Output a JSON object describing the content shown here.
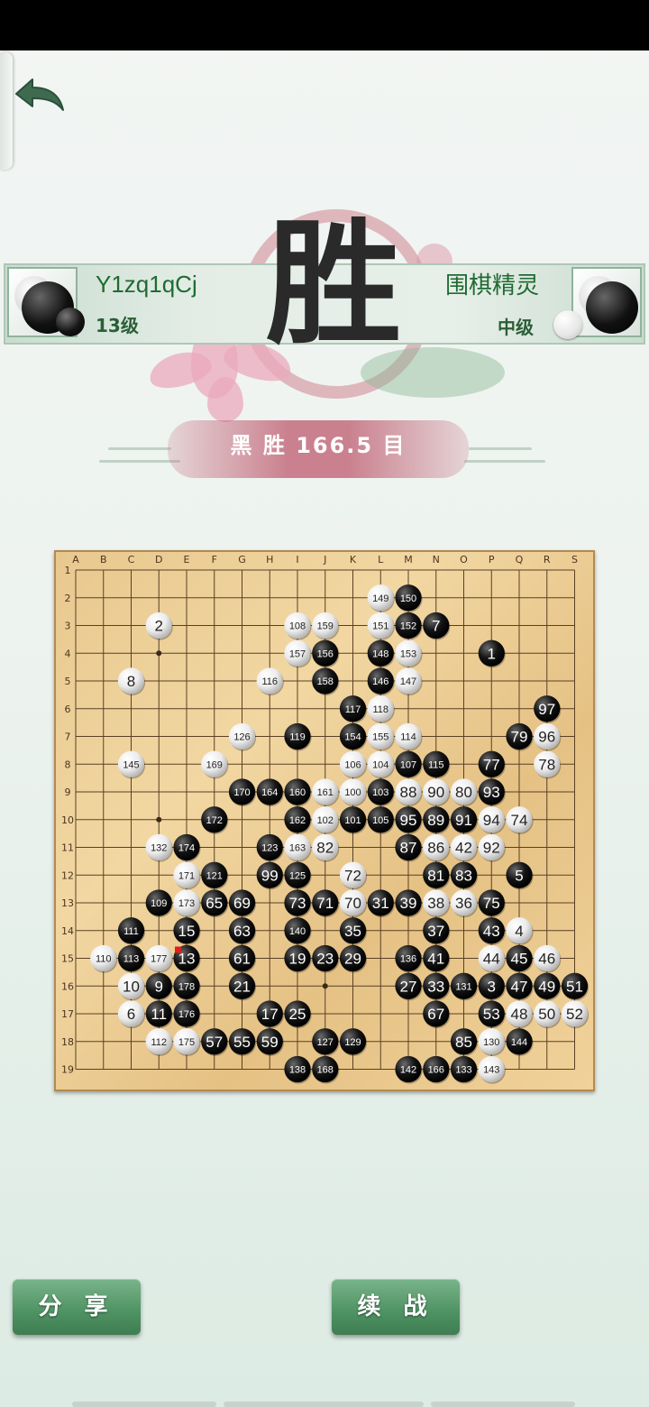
{
  "header": {
    "back_icon": "back-arrow-icon"
  },
  "players": {
    "black": {
      "name": "Y1zq1qCj",
      "rank": "13级",
      "color": "black"
    },
    "white": {
      "name": "围棋精灵",
      "rank": "中级",
      "color": "white"
    }
  },
  "result": {
    "headline": "胜",
    "detail": "黑 胜  166.5 目"
  },
  "board": {
    "size": 19,
    "col_labels": [
      "A",
      "B",
      "C",
      "D",
      "E",
      "F",
      "G",
      "H",
      "I",
      "J",
      "K",
      "L",
      "M",
      "N",
      "O",
      "P",
      "Q",
      "R",
      "S"
    ],
    "row_labels": [
      "1",
      "2",
      "3",
      "4",
      "5",
      "6",
      "7",
      "8",
      "9",
      "10",
      "11",
      "12",
      "13",
      "14",
      "15",
      "16",
      "17",
      "18",
      "19"
    ],
    "last_move_marker": "E15",
    "stones": [
      [
        "L2",
        "w",
        "149"
      ],
      [
        "M2",
        "b",
        "150"
      ],
      [
        "D3",
        "w",
        "2"
      ],
      [
        "I3",
        "w",
        "108"
      ],
      [
        "J3",
        "w",
        "159"
      ],
      [
        "L3",
        "w",
        "151"
      ],
      [
        "M3",
        "b",
        "152"
      ],
      [
        "N3",
        "b",
        "7"
      ],
      [
        "I4",
        "w",
        "157"
      ],
      [
        "J4",
        "b",
        "156"
      ],
      [
        "L4",
        "b",
        "148"
      ],
      [
        "M4",
        "w",
        "153"
      ],
      [
        "P4",
        "b",
        "1"
      ],
      [
        "C5",
        "w",
        "8"
      ],
      [
        "H5",
        "w",
        "116"
      ],
      [
        "J5",
        "b",
        "158"
      ],
      [
        "L5",
        "b",
        "146"
      ],
      [
        "M5",
        "w",
        "147"
      ],
      [
        "K6",
        "b",
        "117"
      ],
      [
        "L6",
        "w",
        "118"
      ],
      [
        "R6",
        "b",
        "97"
      ],
      [
        "G7",
        "w",
        "126"
      ],
      [
        "I7",
        "b",
        "119"
      ],
      [
        "K7",
        "b",
        "154"
      ],
      [
        "L7",
        "w",
        "155"
      ],
      [
        "M7",
        "w",
        "114"
      ],
      [
        "Q7",
        "b",
        "79"
      ],
      [
        "R7",
        "w",
        "96"
      ],
      [
        "C8",
        "w",
        "145"
      ],
      [
        "F8",
        "w",
        "169"
      ],
      [
        "K8",
        "w",
        "106"
      ],
      [
        "L8",
        "w",
        "104"
      ],
      [
        "M8",
        "b",
        "107"
      ],
      [
        "N8",
        "b",
        "115"
      ],
      [
        "P8",
        "b",
        "77"
      ],
      [
        "R8",
        "w",
        "78"
      ],
      [
        "G9",
        "b",
        "170"
      ],
      [
        "H9",
        "b",
        "164"
      ],
      [
        "I9",
        "b",
        "160"
      ],
      [
        "J9",
        "w",
        "161"
      ],
      [
        "K9",
        "w",
        "100"
      ],
      [
        "L9",
        "b",
        "103"
      ],
      [
        "M9",
        "w",
        "88"
      ],
      [
        "N9",
        "w",
        "90"
      ],
      [
        "O9",
        "w",
        "80"
      ],
      [
        "P9",
        "b",
        "93"
      ],
      [
        "F10",
        "b",
        "172"
      ],
      [
        "I10",
        "b",
        "162"
      ],
      [
        "J10",
        "w",
        "102"
      ],
      [
        "K10",
        "b",
        "101"
      ],
      [
        "L10",
        "b",
        "105"
      ],
      [
        "M10",
        "b",
        "95"
      ],
      [
        "N10",
        "b",
        "89"
      ],
      [
        "O10",
        "b",
        "91"
      ],
      [
        "P10",
        "w",
        "94"
      ],
      [
        "Q10",
        "w",
        "74"
      ],
      [
        "D11",
        "w",
        "132"
      ],
      [
        "E11",
        "b",
        "174"
      ],
      [
        "H11",
        "b",
        "123"
      ],
      [
        "I11",
        "w",
        "163"
      ],
      [
        "J11",
        "w",
        "82"
      ],
      [
        "M11",
        "b",
        "87"
      ],
      [
        "N11",
        "w",
        "86"
      ],
      [
        "O11",
        "w",
        "42"
      ],
      [
        "P11",
        "w",
        "92"
      ],
      [
        "E12",
        "w",
        "171"
      ],
      [
        "F12",
        "b",
        "121"
      ],
      [
        "H12",
        "b",
        "99"
      ],
      [
        "I12",
        "b",
        "125"
      ],
      [
        "K12",
        "w",
        "72"
      ],
      [
        "N12",
        "b",
        "81"
      ],
      [
        "O12",
        "b",
        "83"
      ],
      [
        "Q12",
        "b",
        "5"
      ],
      [
        "D13",
        "b",
        "109"
      ],
      [
        "E13",
        "w",
        "173"
      ],
      [
        "F13",
        "b",
        "65"
      ],
      [
        "G13",
        "b",
        "69"
      ],
      [
        "I13",
        "b",
        "73"
      ],
      [
        "J13",
        "b",
        "71"
      ],
      [
        "K13",
        "w",
        "70"
      ],
      [
        "L13",
        "b",
        "31"
      ],
      [
        "M13",
        "b",
        "39"
      ],
      [
        "N13",
        "w",
        "38"
      ],
      [
        "O13",
        "w",
        "36"
      ],
      [
        "P13",
        "b",
        "75"
      ],
      [
        "C14",
        "b",
        "111"
      ],
      [
        "E14",
        "b",
        "15"
      ],
      [
        "G14",
        "b",
        "63"
      ],
      [
        "I14",
        "b",
        "140"
      ],
      [
        "K14",
        "b",
        "35"
      ],
      [
        "N14",
        "b",
        "37"
      ],
      [
        "P14",
        "b",
        "43"
      ],
      [
        "Q14",
        "w",
        "4"
      ],
      [
        "B15",
        "w",
        "110"
      ],
      [
        "C15",
        "b",
        "113"
      ],
      [
        "D15",
        "w",
        "177"
      ],
      [
        "E15",
        "b",
        "13"
      ],
      [
        "G15",
        "b",
        "61"
      ],
      [
        "I15",
        "b",
        "19"
      ],
      [
        "J15",
        "b",
        "23"
      ],
      [
        "K15",
        "b",
        "29"
      ],
      [
        "M15",
        "b",
        "136"
      ],
      [
        "N15",
        "b",
        "41"
      ],
      [
        "P15",
        "w",
        "44"
      ],
      [
        "Q15",
        "b",
        "45"
      ],
      [
        "R15",
        "w",
        "46"
      ],
      [
        "C16",
        "w",
        "10"
      ],
      [
        "D16",
        "b",
        "9"
      ],
      [
        "E16",
        "b",
        "178"
      ],
      [
        "G16",
        "b",
        "21"
      ],
      [
        "M16",
        "b",
        "27"
      ],
      [
        "N16",
        "b",
        "33"
      ],
      [
        "O16",
        "b",
        "131"
      ],
      [
        "P16",
        "b",
        "3"
      ],
      [
        "Q16",
        "b",
        "47"
      ],
      [
        "R16",
        "b",
        "49"
      ],
      [
        "S16",
        "b",
        "51"
      ],
      [
        "C17",
        "w",
        "6"
      ],
      [
        "D17",
        "b",
        "11"
      ],
      [
        "E17",
        "b",
        "176"
      ],
      [
        "H17",
        "b",
        "17"
      ],
      [
        "I17",
        "b",
        "25"
      ],
      [
        "N17",
        "b",
        "67"
      ],
      [
        "P17",
        "b",
        "53"
      ],
      [
        "Q17",
        "w",
        "48"
      ],
      [
        "R17",
        "w",
        "50"
      ],
      [
        "S17",
        "w",
        "52"
      ],
      [
        "D18",
        "w",
        "112"
      ],
      [
        "E18",
        "w",
        "175"
      ],
      [
        "F18",
        "b",
        "57"
      ],
      [
        "G18",
        "b",
        "55"
      ],
      [
        "H18",
        "b",
        "59"
      ],
      [
        "J18",
        "b",
        "127"
      ],
      [
        "K18",
        "b",
        "129"
      ],
      [
        "O18",
        "b",
        "85"
      ],
      [
        "P18",
        "w",
        "130"
      ],
      [
        "Q18",
        "b",
        "144"
      ],
      [
        "I19",
        "b",
        "138"
      ],
      [
        "J19",
        "b",
        "168"
      ],
      [
        "M19",
        "b",
        "142"
      ],
      [
        "N19",
        "b",
        "166"
      ],
      [
        "O19",
        "b",
        "133"
      ],
      [
        "P19",
        "w",
        "143"
      ]
    ]
  },
  "actions": {
    "share": "分 享",
    "continue": "续 战"
  }
}
